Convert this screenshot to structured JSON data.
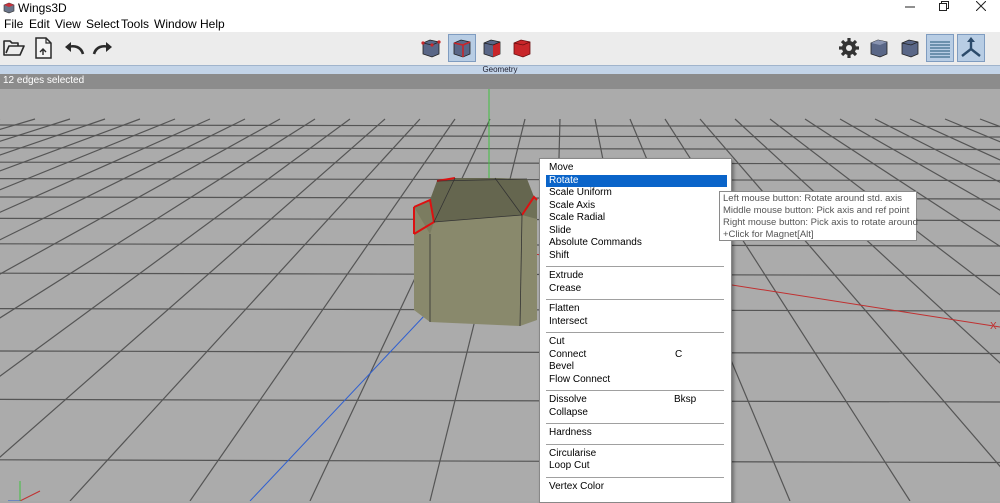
{
  "window": {
    "title": "Wings3D",
    "controls": [
      "minimize",
      "restore",
      "close"
    ]
  },
  "menubar": {
    "items": [
      "File",
      "Edit",
      "View",
      "Select",
      "Tools",
      "Window",
      "Help"
    ]
  },
  "toolbar": {
    "left_icons": [
      "open-folder-icon",
      "save-icon",
      "undo-icon",
      "redo-icon"
    ],
    "selection_modes": [
      "vertex-mode-icon",
      "edge-mode-icon",
      "face-mode-icon",
      "object-mode-icon"
    ],
    "active_mode": "edge-mode-icon",
    "right_icons": [
      "gear-icon",
      "smooth-preview-icon",
      "flat-shaded-icon",
      "ground-plane-icon",
      "axes-toggle-icon"
    ],
    "colors": {
      "cube_face": "#5a6787",
      "cube_red": "#c8262a",
      "active_bg": "#b8cde4"
    }
  },
  "geometry_window": {
    "title": "Geometry"
  },
  "status": {
    "text": "12 edges selected"
  },
  "viewport": {
    "axis_labels": {
      "x": "X"
    },
    "colors": {
      "background": "#ababab",
      "grid": "#555555",
      "x_axis": "#c03030",
      "y_axis": "#40c040",
      "z_axis": "#2f5fd0",
      "selection": "#dd1111"
    }
  },
  "context_menu": {
    "items": [
      {
        "label": "Move"
      },
      {
        "label": "Rotate",
        "highlighted": true
      },
      {
        "label": "Scale Uniform"
      },
      {
        "label": "Scale Axis"
      },
      {
        "label": "Scale Radial"
      },
      {
        "label": "Slide"
      },
      {
        "label": "Absolute Commands"
      },
      {
        "label": "Shift"
      },
      {
        "separator": true
      },
      {
        "label": "Extrude"
      },
      {
        "label": "Crease"
      },
      {
        "separator": true
      },
      {
        "label": "Flatten"
      },
      {
        "label": "Intersect"
      },
      {
        "separator": true
      },
      {
        "label": "Cut"
      },
      {
        "label": "Connect",
        "shortcut": "C"
      },
      {
        "label": "Bevel"
      },
      {
        "label": "Flow Connect"
      },
      {
        "separator": true
      },
      {
        "label": "Dissolve",
        "shortcut": "Bksp"
      },
      {
        "label": "Collapse"
      },
      {
        "separator": true
      },
      {
        "label": "Hardness"
      },
      {
        "separator": true
      },
      {
        "label": "Circularise"
      },
      {
        "label": "Loop Cut"
      },
      {
        "separator": true
      },
      {
        "label": "Vertex Color"
      }
    ]
  },
  "tooltip": {
    "lines": [
      "Left mouse button: Rotate around std. axis",
      "Middle mouse button: Pick axis and ref point",
      "Right mouse button: Pick axis to rotate around",
      "+Click for Magnet[Alt]"
    ]
  }
}
